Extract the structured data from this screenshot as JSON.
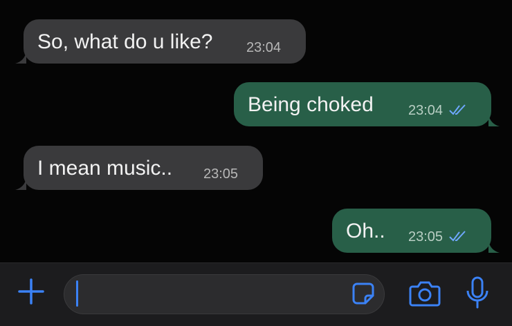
{
  "colors": {
    "background": "#050505",
    "incoming_bubble": "#3a3a3c",
    "outgoing_bubble": "#285f48",
    "read_ticks": "#6fa8ff",
    "composer_bar": "#1c1c1e",
    "icon_blue": "#3b82f6"
  },
  "messages": [
    {
      "direction": "incoming",
      "text": "So, what do u like?",
      "time": "23:04"
    },
    {
      "direction": "outgoing",
      "text": "Being choked",
      "time": "23:04",
      "status_icon": "double-check-read-icon"
    },
    {
      "direction": "incoming",
      "text": "I mean music..",
      "time": "23:05"
    },
    {
      "direction": "outgoing",
      "text": "Oh..",
      "time": "23:05",
      "status_icon": "double-check-read-icon"
    }
  ],
  "composer": {
    "input_value": "",
    "icons": [
      "plus-icon",
      "sticker-icon",
      "camera-icon",
      "microphone-icon"
    ]
  }
}
